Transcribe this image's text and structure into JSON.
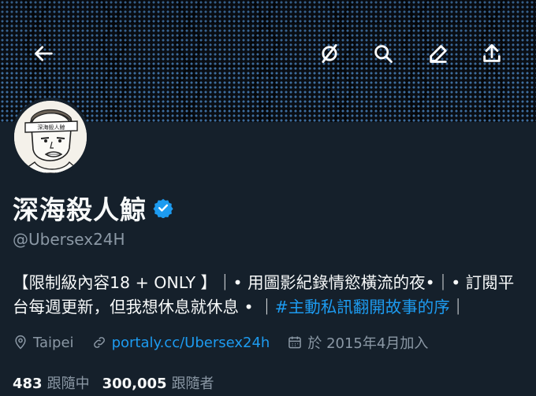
{
  "header": {
    "back_icon": "arrow-left-icon",
    "grok_icon": "grok-icon",
    "search_icon": "search-icon",
    "edit_icon": "edit-icon",
    "share_icon": "share-icon"
  },
  "avatar": {
    "headband_text": "深海殺人鯨"
  },
  "profile": {
    "name": "深海殺人鯨",
    "handle": "@Ubersex24H",
    "bio_text": "【限制級內容18 + ONLY 】｜• 用圖影紀錄情慾橫流的夜•｜• 訂閱平台每週更新，但我想休息就休息 • ｜",
    "bio_hashtag": "#主動私訊翻開故事的序",
    "bio_end": "｜",
    "location": "Taipei",
    "link": "portaly.cc/Ubersex24h",
    "joined": "於 2015年4月加入"
  },
  "stats": {
    "following_count": "483",
    "following_label": "跟隨中",
    "followers_count": "300,005",
    "followers_label": "跟隨者"
  },
  "colors": {
    "background": "#15202b",
    "accent": "#1d9bf0",
    "secondary_text": "#8b98a5",
    "verified": "#1d9bf0"
  }
}
